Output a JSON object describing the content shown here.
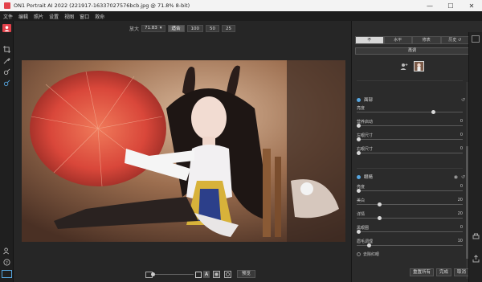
{
  "window": {
    "title": "ON1 Portrait AI 2022 (221917-16337027576bcb.jpg @ 71.8% 8-bit)",
    "minimize": "—",
    "maximize": "☐",
    "close": "✕"
  },
  "menu": [
    "文件",
    "编辑",
    "照片",
    "设置",
    "视图",
    "窗口",
    "救命"
  ],
  "toolbar": {
    "zoom_label": "放大",
    "zoom_value": "71.83",
    "fit_label": "适合",
    "presets": [
      "100",
      "50",
      "25"
    ]
  },
  "panel": {
    "tabs": [
      "不",
      "水平",
      "修表",
      "历史 ↺"
    ],
    "sub_tab": "再调",
    "face_section": {
      "title": "面部",
      "sliders": [
        {
          "label": "亮度",
          "value": "",
          "level": 0.72
        },
        {
          "label": "营养启动",
          "value": "0",
          "level": 0.0
        },
        {
          "label": "左眼尺寸",
          "value": "0",
          "level": 0.0
        },
        {
          "label": "右眼尺寸",
          "value": "0",
          "level": 0.0
        }
      ]
    },
    "eyes_section": {
      "title": "眼睛",
      "sliders": [
        {
          "label": "亮度",
          "value": "0",
          "level": 0.0
        },
        {
          "label": "美白",
          "value": "20",
          "level": 0.2
        },
        {
          "label": "详情",
          "value": "20",
          "level": 0.2
        },
        {
          "label": "黑眼圈",
          "value": "0",
          "level": 0.0
        },
        {
          "label": "眉毛调理",
          "value": "10",
          "level": 0.1
        }
      ],
      "checkbox_label": "去除红眼"
    },
    "buttons": {
      "reset_all": "重置所有",
      "done": "完成",
      "cancel": "取消"
    }
  },
  "bottom": {
    "preview": "预览",
    "mode_a": "A"
  },
  "colors": {
    "accent": "#56a6e0",
    "brand": "#e3414a"
  }
}
